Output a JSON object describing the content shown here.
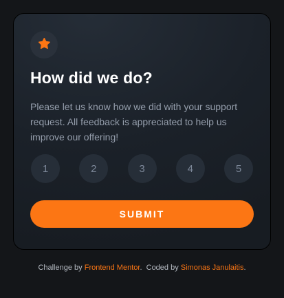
{
  "card": {
    "icon": "star-icon",
    "title": "How did we do?",
    "description": "Please let us know how we did with your support request. All feedback is appreciated to help us improve our offering!",
    "ratings": [
      "1",
      "2",
      "3",
      "4",
      "5"
    ],
    "submit_label": "SUBMIT"
  },
  "attribution": {
    "challenge_prefix": "Challenge by",
    "challenge_link": "Frontend Mentor",
    "challenge_suffix": ".",
    "coded_prefix": "Coded by",
    "coded_link": "Simonas Janulaitis",
    "coded_suffix": "."
  },
  "colors": {
    "accent": "#fc7614",
    "page_background": "#141619",
    "card_background": "#1e252e",
    "rating_background": "#262e38",
    "text_muted": "#959eac"
  }
}
